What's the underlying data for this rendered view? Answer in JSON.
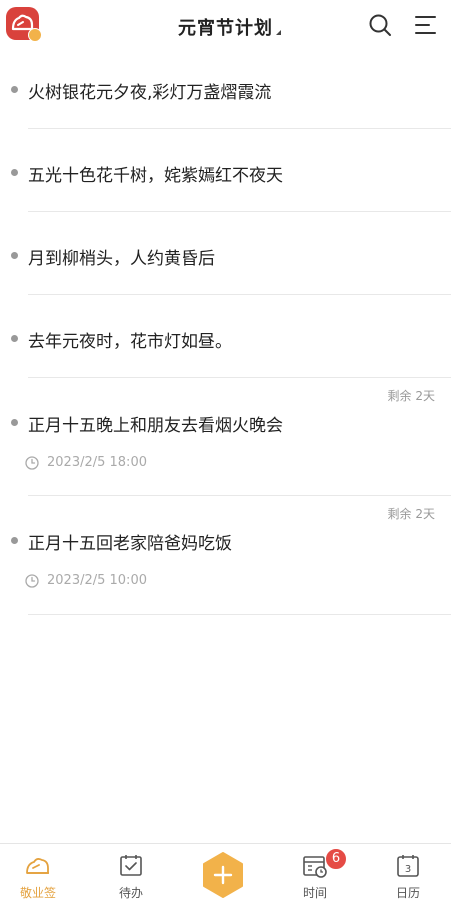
{
  "header": {
    "title": "元宵节计划",
    "logo_icon": "app-logo-icon",
    "search_icon": "search-icon",
    "menu_icon": "menu-icon"
  },
  "items": [
    {
      "text": "火树银花元夕夜,彩灯万盏熠霞流"
    },
    {
      "text": "五光十色花千树，姹紫嫣红不夜天"
    },
    {
      "text": "月到柳梢头，人约黄昏后"
    },
    {
      "text": "去年元夜时，花市灯如昼。"
    },
    {
      "text": "正月十五晚上和朋友去看烟火晚会",
      "remain": "剩余 2天",
      "time": "2023/2/5 18:00"
    },
    {
      "text": "正月十五回老家陪爸妈吃饭",
      "remain": "剩余 2天",
      "time": "2023/2/5 10:00"
    }
  ],
  "tabbar": {
    "tabs": [
      {
        "label": "敬业签",
        "icon": "cloud-note-icon",
        "active": true
      },
      {
        "label": "待办",
        "icon": "todo-check-icon"
      },
      {
        "label": "",
        "icon": "add-icon"
      },
      {
        "label": "时间",
        "icon": "calendar-clock-icon",
        "badge": "6"
      },
      {
        "label": "日历",
        "icon": "calendar-icon",
        "day": "3"
      }
    ]
  },
  "colors": {
    "brand_red": "#d9423c",
    "accent_orange": "#e4a23f",
    "badge_red": "#e54b45"
  }
}
